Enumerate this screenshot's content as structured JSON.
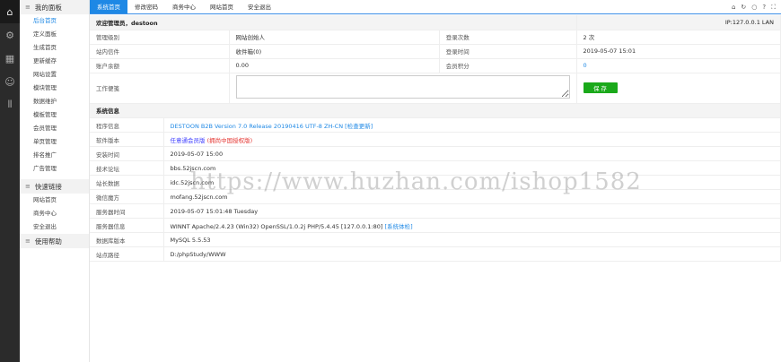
{
  "iconbar": [
    "home-icon",
    "gear-icon",
    "grid-icon",
    "user-icon",
    "stats-icon"
  ],
  "sidebar": {
    "groups": [
      {
        "title": "我的面板",
        "items": [
          "后台首页",
          "定义面板",
          "生成首页",
          "更新缓存",
          "网站设置",
          "模块管理",
          "数据维护",
          "模板管理",
          "会员管理",
          "单页管理",
          "排名推广",
          "广告管理"
        ]
      },
      {
        "title": "快速链接",
        "items": [
          "网站首页",
          "商务中心",
          "安全退出"
        ]
      },
      {
        "title": "使用帮助",
        "items": []
      }
    ]
  },
  "tabs": [
    "系统首页",
    "修改密码",
    "商务中心",
    "网站首页",
    "安全退出"
  ],
  "welcome": {
    "title": "欢迎管理员，destoon",
    "ip": "IP:127.0.0.1 LAN"
  },
  "account": [
    [
      "管理级别",
      "网站创始人",
      "登录次数",
      "2 次"
    ],
    [
      "站内信件",
      "收件箱(0)",
      "登录时间",
      "2019-05-07 15:01"
    ],
    [
      "账户余额",
      "0.00",
      "会员积分",
      "0"
    ]
  ],
  "notes": {
    "label": "工作便笺",
    "value": "",
    "save": "保 存"
  },
  "sysinfo": {
    "title": "系统信息",
    "program_label": "程序信息",
    "program": "DESTOON B2B Version 7.0 Release 20190416 UTF-8 ZH-CN",
    "check_update": "[检查更新]",
    "edition_label": "软件版本",
    "edition": "任意通会员版",
    "edition_note": "(拥尚中国授权版)",
    "rows": [
      [
        "安装时间",
        "2019-05-07 15:00"
      ],
      [
        "技术论坛",
        "bbs.52jscn.com"
      ],
      [
        "站长数据",
        "idc.52jscn.com"
      ],
      [
        "微信魔方",
        "mofang.52jscn.com"
      ],
      [
        "服务器时间",
        "2019-05-07 15:01:48 Tuesday"
      ]
    ],
    "server_label": "服务器信息",
    "server": "WINNT Apache/2.4.23 (Win32) OpenSSL/1.0.2j PHP/5.4.45 [127.0.0.1:80]",
    "sys_check": "[系统体检]",
    "rows2": [
      [
        "数据库版本",
        "MySQL 5.5.53"
      ],
      [
        "站点路径",
        "D:/phpStudy/WWW"
      ]
    ]
  },
  "watermark": "https://www.huzhan.com/ishop1582"
}
